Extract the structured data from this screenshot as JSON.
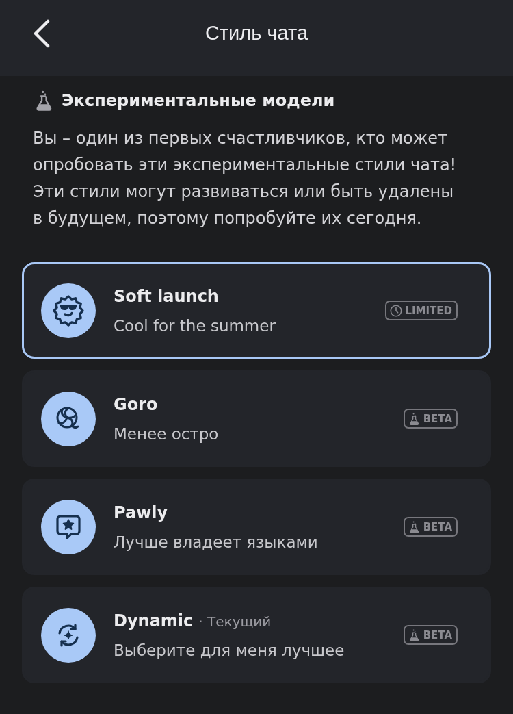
{
  "header": {
    "title": "Стиль чата"
  },
  "section": {
    "title": "Экспериментальные модели",
    "description": "Вы – один из первых счастливчиков, кто может опробовать эти экспериментальные стили чата! Эти стили могут развиваться или быть удалены в будущем, поэтому попробуйте их сегодня."
  },
  "styles": [
    {
      "name": "Soft launch",
      "description": "Cool for the summer",
      "selected": true,
      "badge": {
        "kind": "limited",
        "label": "LIMITED"
      }
    },
    {
      "name": "Goro",
      "description": "Менее остро",
      "selected": false,
      "badge": {
        "kind": "beta",
        "label": "BETA"
      }
    },
    {
      "name": "Pawly",
      "description": "Лучше владеет языками",
      "selected": false,
      "badge": {
        "kind": "beta",
        "label": "BETA"
      }
    },
    {
      "name": "Dynamic",
      "note": "· Текущий",
      "description": "Выберите для меня лучшее",
      "selected": false,
      "badge": {
        "kind": "beta",
        "label": "BETA"
      }
    }
  ]
}
